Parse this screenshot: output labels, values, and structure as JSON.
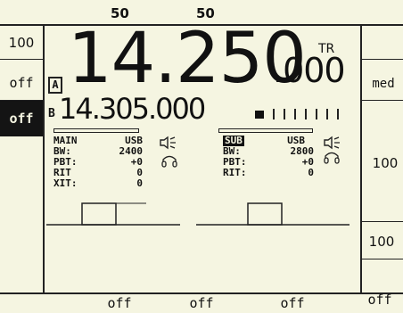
{
  "top_bar": {
    "left_value": "50",
    "right_value": "50"
  },
  "left_keys": [
    "100",
    "off",
    "off"
  ],
  "right_keys": [
    "med",
    "100",
    "100"
  ],
  "bottom_keys": [
    "off",
    "off",
    "off",
    "off"
  ],
  "vfo_a": {
    "indicator": "A",
    "freq_main": "14.250",
    "freq_decimals": ".000",
    "tx_label": "TR"
  },
  "vfo_b": {
    "indicator": "B",
    "freq": "14.305.000",
    "s_meter_level": 0.1
  },
  "main_rx": {
    "title": "MAIN",
    "mode": "USB",
    "rows": [
      {
        "label": "BW:",
        "value": "2400"
      },
      {
        "label": "PBT:",
        "value": "+0"
      },
      {
        "label": "RIT",
        "value": "0"
      },
      {
        "label": "XIT:",
        "value": "0"
      }
    ]
  },
  "sub_rx": {
    "title": "SUB",
    "mode": "USB",
    "rows": [
      {
        "label": "BW:",
        "value": "2800"
      },
      {
        "label": "PBT:",
        "value": "+0"
      },
      {
        "label": "RIT:",
        "value": "0"
      }
    ]
  },
  "icons": [
    "speaker-icon",
    "headphones-icon"
  ]
}
